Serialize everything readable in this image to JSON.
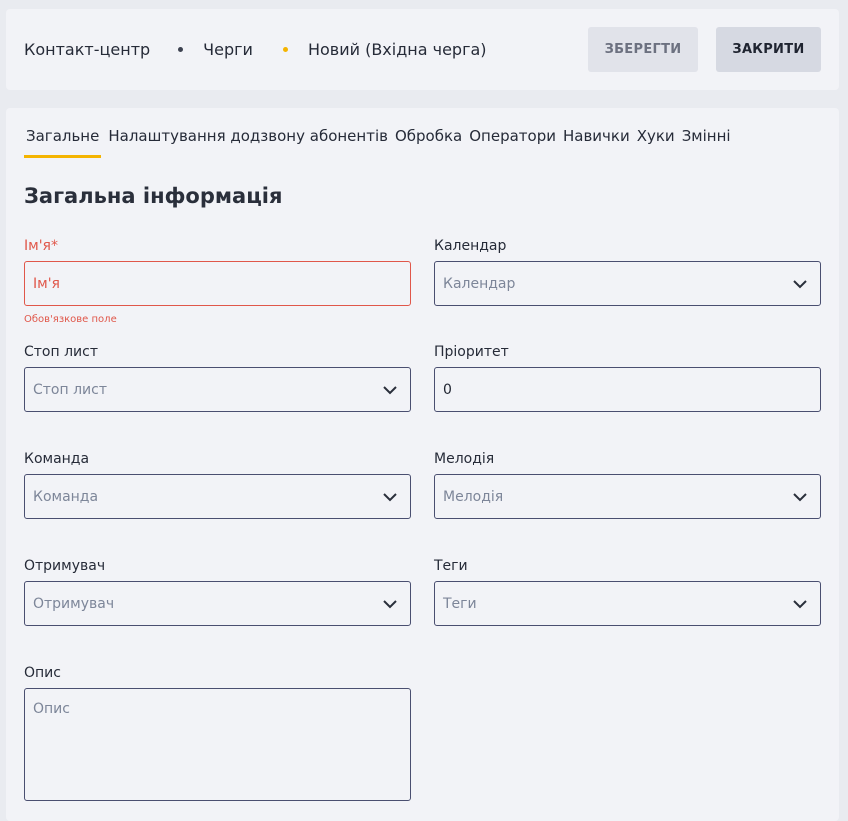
{
  "header": {
    "breadcrumbs": [
      "Контакт-центр",
      "Черги",
      "Новий (Вхідна черга)"
    ],
    "save_label": "ЗБЕРЕГТИ",
    "close_label": "ЗАКРИТИ"
  },
  "tabs": [
    "Загальне",
    "Налаштування додзвону абонентів",
    "Обробка",
    "Оператори",
    "Навички",
    "Хуки",
    "Змінні"
  ],
  "active_tab": "Загальне",
  "section_title": "Загальна інформація",
  "fields": {
    "name": {
      "label": "Ім'я*",
      "placeholder": "Ім'я",
      "error": "Обов'язкове поле"
    },
    "calendar": {
      "label": "Календар",
      "placeholder": "Календар"
    },
    "stop_list": {
      "label": "Стоп лист",
      "placeholder": "Стоп лист"
    },
    "priority": {
      "label": "Пріоритет",
      "value": "0"
    },
    "team": {
      "label": "Команда",
      "placeholder": "Команда"
    },
    "melody": {
      "label": "Мелодія",
      "placeholder": "Мелодія"
    },
    "recipient": {
      "label": "Отримувач",
      "placeholder": "Отримувач"
    },
    "tags": {
      "label": "Теги",
      "placeholder": "Теги"
    },
    "description": {
      "label": "Опис",
      "placeholder": "Опис"
    }
  },
  "colors": {
    "accent": "#f4b400",
    "error": "#e0574a",
    "border": "#4a4f70"
  },
  "icons": {
    "dropdown": "chevron-down-icon"
  }
}
